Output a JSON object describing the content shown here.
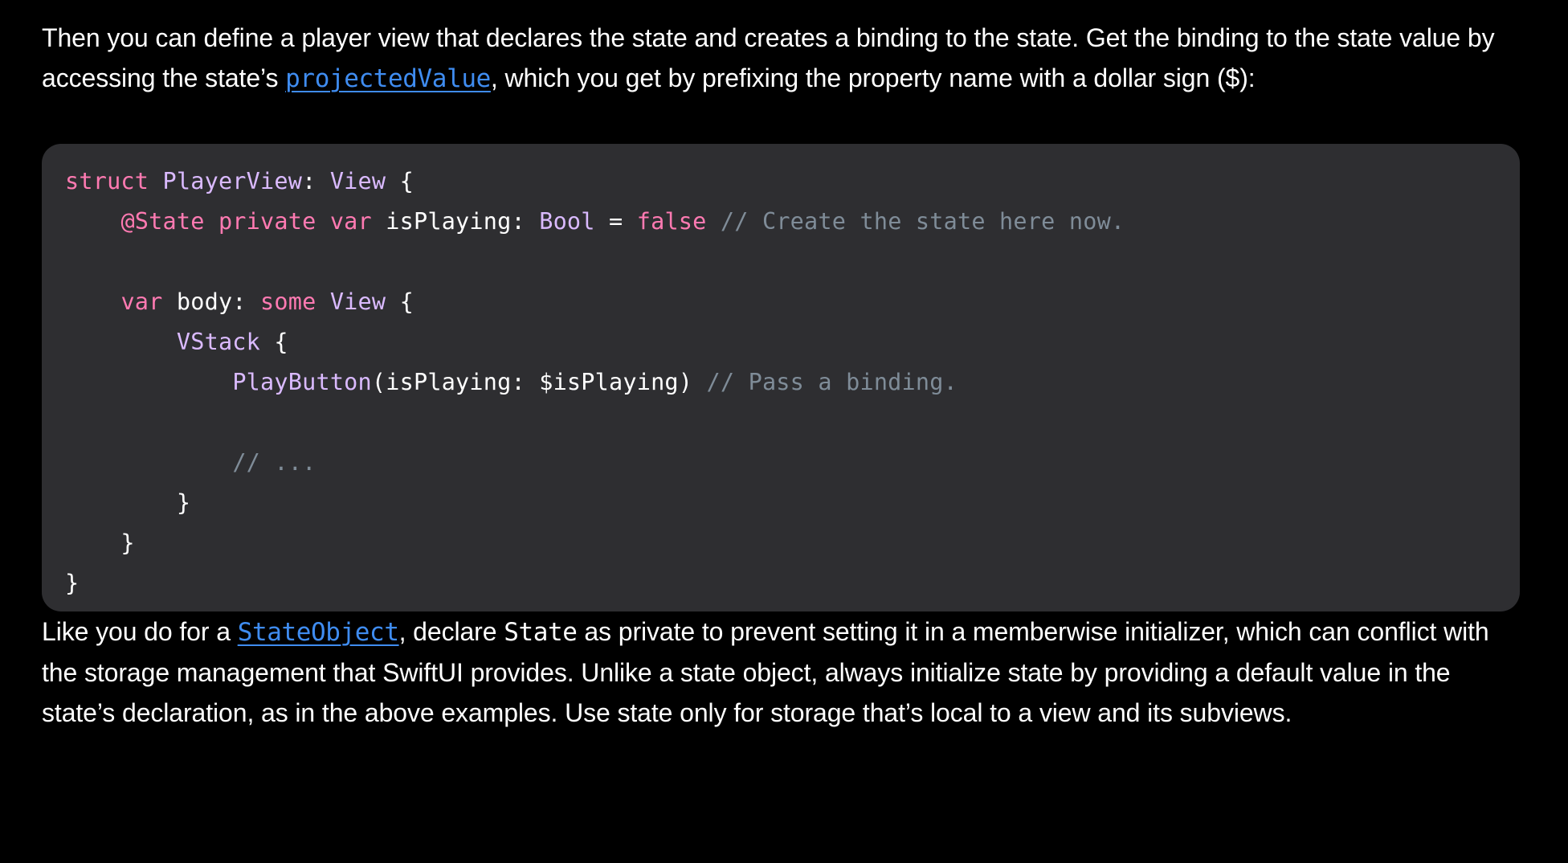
{
  "intro": {
    "text_before_link": "Then you can define a player view that declares the state and creates a binding to the state. Get the binding to the state value by accessing the state’s ",
    "link": "projectedValue",
    "text_after_link": ", which you get by prefixing the property name with a dollar sign ($):"
  },
  "code": {
    "line1": {
      "t0": "struct",
      "t1": " ",
      "t2": "PlayerView",
      "t3": ": ",
      "t4": "View",
      "t5": " {"
    },
    "line2": {
      "t0": "    ",
      "t1": "@State",
      "t2": " ",
      "t3": "private",
      "t4": " ",
      "t5": "var",
      "t6": " isPlaying: ",
      "t7": "Bool",
      "t8": " = ",
      "t9": "false",
      "t10": " ",
      "t11": "// Create the state here now."
    },
    "line4": {
      "t0": "    ",
      "t1": "var",
      "t2": " body: ",
      "t3": "some",
      "t4": " ",
      "t5": "View",
      "t6": " {"
    },
    "line5": {
      "t0": "        ",
      "t1": "VStack",
      "t2": " {"
    },
    "line6": {
      "t0": "            ",
      "t1": "PlayButton",
      "t2": "(isPlaying: $isPlaying) ",
      "t3": "// Pass a binding."
    },
    "line8": {
      "t0": "            ",
      "t1": "// ..."
    },
    "line9": {
      "t0": "        }"
    },
    "line10": {
      "t0": "    }"
    },
    "line11": {
      "t0": "}"
    }
  },
  "outro": {
    "text_before_link": "Like you do for a ",
    "link": "StateObject",
    "text_middle": ", declare ",
    "inline_code": "State",
    "text_after": " as private to prevent setting it in a memberwise initializer, which can conflict with the storage management that SwiftUI provides. Unlike a state object, always initialize state by providing a default value in the state’s declaration, as in the above examples. Use state only for storage that’s local to a view and its subviews."
  },
  "colors": {
    "background": "#000000",
    "code_background": "#2e2e31",
    "link": "#3f8cf0",
    "keyword": "#ff7ab2",
    "type": "#dabaff",
    "comment": "#7f8c98"
  }
}
